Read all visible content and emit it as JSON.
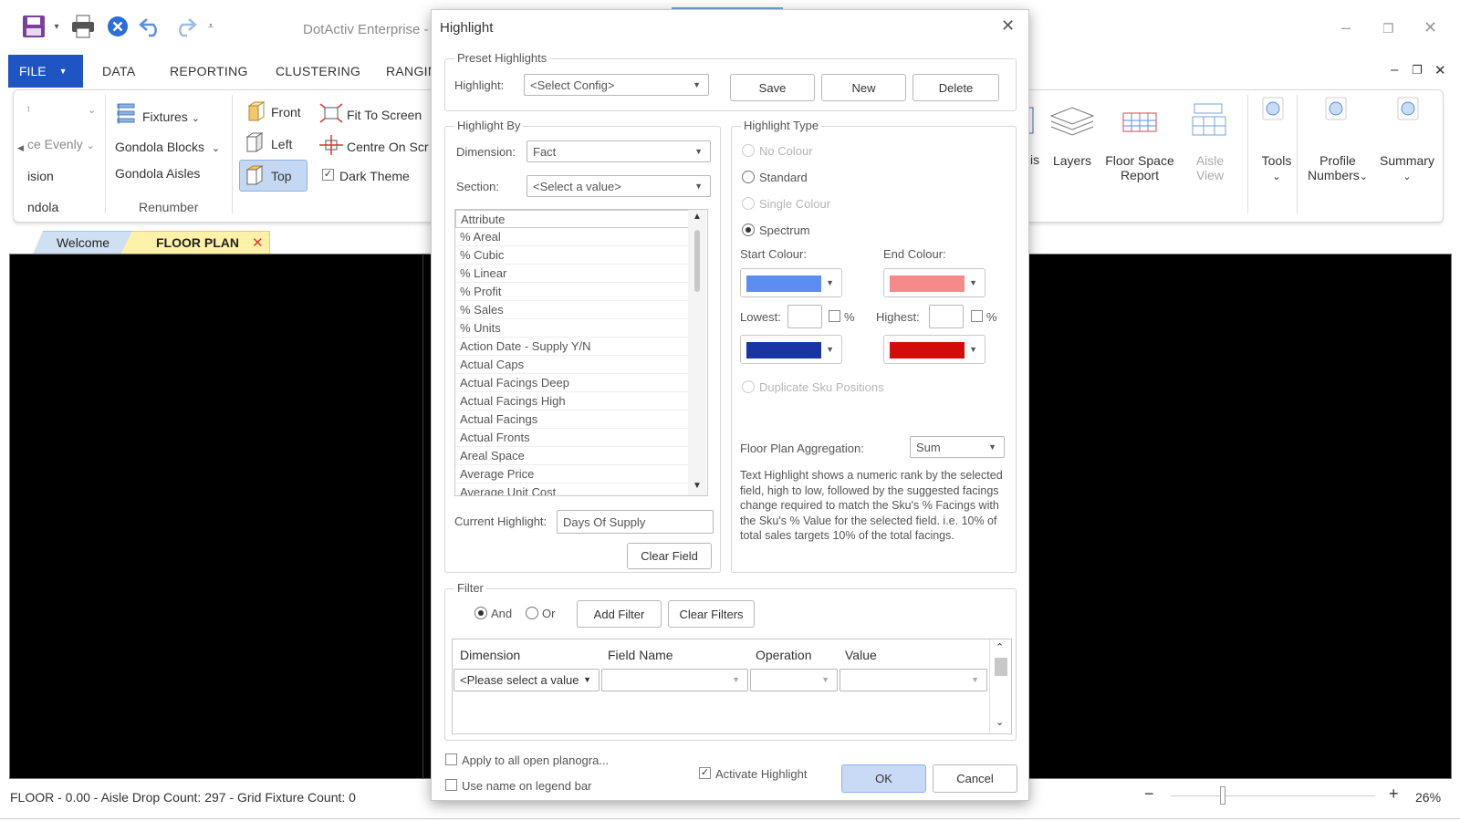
{
  "app": {
    "title": "DotActiv Enterprise -",
    "menu_tabs": [
      "FILE",
      "DATA",
      "REPORTING",
      "CLUSTERING",
      "RANGIN"
    ]
  },
  "ribbon": {
    "partial_items": [
      "ce Evenly",
      "ision",
      "ndola"
    ],
    "fixtures_label": "Fixtures",
    "gondola_blocks_label": "Gondola Blocks",
    "gondola_aisles_label": "Gondola Aisles",
    "renumber_group_label": "Renumber",
    "front_label": "Front",
    "left_label": "Left",
    "top_label": "Top",
    "fit_to_screen_label": "Fit To Screen",
    "centre_on_screen_label": "Centre On Scr",
    "dark_theme_label": "Dark Theme",
    "dark_theme_checked": true,
    "right_partial": "is",
    "layers_label": "Layers",
    "floor_space_report_label": [
      "Floor Space",
      "Report"
    ],
    "aisle_view_label": [
      "Aisle",
      "View"
    ],
    "tools_label": "Tools",
    "profile_numbers_label": [
      "Profile",
      "Numbers"
    ],
    "summary_label": "Summary"
  },
  "doc_tabs": {
    "welcome": "Welcome",
    "floor_plan": "FLOOR PLAN"
  },
  "status": {
    "text": "FLOOR - 0.00 - Aisle Drop Count: 297 - Grid Fixture Count: 0",
    "zoom": "26%"
  },
  "dialog": {
    "title": "Highlight",
    "preset": {
      "group_title": "Preset Highlights",
      "highlight_label": "Highlight:",
      "highlight_value": "<Select Config>",
      "save": "Save",
      "new": "New",
      "delete": "Delete"
    },
    "highlight_by": {
      "group_title": "Highlight By",
      "dimension_label": "Dimension:",
      "dimension_value": "Fact",
      "section_label": "Section:",
      "section_value": "<Select a value>",
      "list_items": [
        "Attribute",
        "% Areal",
        "% Cubic",
        "% Linear",
        "% Profit",
        "% Sales",
        "% Units",
        "Action Date - Supply Y/N",
        "Actual Caps",
        "Actual Facings Deep",
        "Actual Facings High",
        "Actual Facings",
        "Actual Fronts",
        "Areal Space",
        "Average Price",
        "Average Unit Cost"
      ],
      "current_label": "Current Highlight:",
      "current_value": "Days Of Supply",
      "clear_field": "Clear Field"
    },
    "highlight_type": {
      "group_title": "Highlight Type",
      "options": [
        "No Colour",
        "Standard",
        "Single Colour",
        "Spectrum"
      ],
      "selected": "Spectrum",
      "start_colour_label": "Start Colour:",
      "end_colour_label": "End Colour:",
      "start_colour": "#5b8ef0",
      "end_colour": "#f58a8a",
      "lowest_label": "Lowest:",
      "highest_label": "Highest:",
      "percent": "%",
      "low_colour": "#1835a3",
      "high_colour": "#d40b0b",
      "duplicate_label": "Duplicate Sku Positions",
      "aggregation_label": "Floor Plan Aggregation:",
      "aggregation_value": "Sum",
      "description": "Text Highlight shows a numeric rank by the selected field, high to low, followed by the suggested facings change required to match the Sku's % Facings with the Sku's % Value for the selected field. i.e. 10% of total sales targets 10% of the total facings."
    },
    "filter": {
      "group_title": "Filter",
      "and_label": "And",
      "or_label": "Or",
      "add_filter": "Add Filter",
      "clear_filters": "Clear Filters",
      "columns": [
        "Dimension",
        "Field Name",
        "Operation",
        "Value"
      ],
      "row_dimension": "<Please select a value"
    },
    "apply_all_label": "Apply to all open planogra...",
    "use_name_label": "Use name on legend bar",
    "activate_label": "Activate Highlight",
    "ok": "OK",
    "cancel": "Cancel"
  }
}
